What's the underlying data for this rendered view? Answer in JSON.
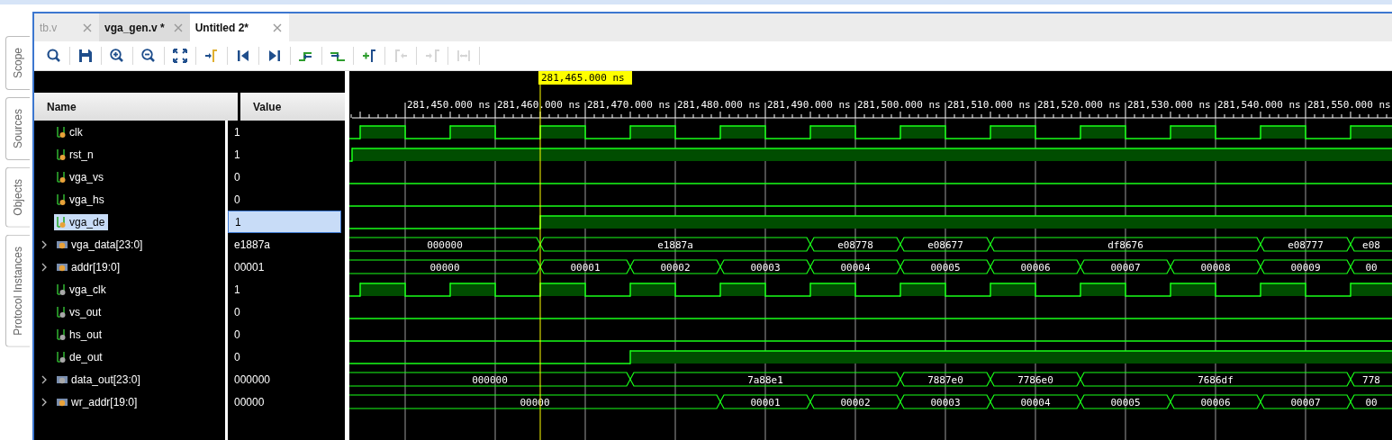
{
  "sidebar_tabs": [
    {
      "label": "Scope"
    },
    {
      "label": "Sources"
    },
    {
      "label": "Objects"
    },
    {
      "label": "Protocol Instances"
    }
  ],
  "tabs": [
    {
      "label": "tb.v",
      "selected": false,
      "dimmed": true
    },
    {
      "label": "vga_gen.v *",
      "selected": false,
      "dimmed": false
    },
    {
      "label": "Untitled 2*",
      "selected": true,
      "dimmed": false
    }
  ],
  "toolbar": [
    {
      "kind": "search",
      "disabled": false
    },
    {
      "kind": "save",
      "disabled": false
    },
    {
      "kind": "zoom-in",
      "disabled": false
    },
    {
      "kind": "zoom-out",
      "disabled": false
    },
    {
      "kind": "zoom-fit",
      "disabled": false
    },
    {
      "kind": "go-cursor",
      "disabled": false
    },
    {
      "kind": "go-start",
      "disabled": false
    },
    {
      "kind": "go-end",
      "disabled": false
    },
    {
      "kind": "prev-transition",
      "disabled": false
    },
    {
      "kind": "next-transition",
      "disabled": false
    },
    {
      "kind": "add-marker",
      "disabled": false
    },
    {
      "kind": "prev-marker",
      "disabled": true
    },
    {
      "kind": "next-marker",
      "disabled": true
    },
    {
      "kind": "swap-markers",
      "disabled": true
    }
  ],
  "columns": {
    "name": "Name",
    "value": "Value"
  },
  "waveform": {
    "cursor": "281,465.000 ns",
    "time_labels": [
      "281,450.000 ns",
      "281,460.000 ns",
      "281,470.000 ns",
      "281,480.000 ns",
      "281,490.000 ns",
      "281,500.000 ns",
      "281,510.000 ns",
      "281,520.000 ns",
      "281,530.000 ns",
      "281,540.000 ns",
      "281,550.000 ns"
    ]
  },
  "signals": [
    {
      "name": "clk",
      "value": "1",
      "kind": "bit",
      "color": "#e8a23a",
      "selected": false,
      "segments": [
        {
          "high": false
        },
        {
          "high": true
        },
        {
          "high": false
        },
        {
          "high": true
        },
        {
          "high": false
        },
        {
          "high": true
        },
        {
          "high": false
        },
        {
          "high": true
        },
        {
          "high": false
        },
        {
          "high": true
        },
        {
          "high": false
        },
        {
          "high": true
        },
        {
          "high": false
        },
        {
          "high": true
        },
        {
          "high": false
        },
        {
          "high": true
        },
        {
          "high": false
        },
        {
          "high": true
        },
        {
          "high": false
        },
        {
          "high": true
        },
        {
          "high": false
        },
        {
          "high": true
        },
        {
          "high": false
        },
        {
          "high": true
        }
      ]
    },
    {
      "name": "rst_n",
      "value": "1",
      "kind": "bit",
      "color": "#e8a23a",
      "selected": false,
      "segments": [
        {
          "high": false
        },
        {
          "high": true
        }
      ]
    },
    {
      "name": "vga_vs",
      "value": "0",
      "kind": "bit",
      "color": "#e8a23a",
      "selected": false,
      "segments": [
        {
          "high": false
        }
      ]
    },
    {
      "name": "vga_hs",
      "value": "0",
      "kind": "bit",
      "color": "#e8a23a",
      "selected": false,
      "segments": [
        {
          "high": false
        }
      ]
    },
    {
      "name": "vga_de",
      "value": "1",
      "kind": "bit",
      "color": "#e8a23a",
      "selected": true,
      "segments": [
        {
          "high": false
        },
        {
          "high": true
        }
      ]
    },
    {
      "name": "vga_data[23:0]",
      "value": "e1887a",
      "kind": "bus",
      "color": "#e8a23a",
      "selected": false,
      "expanded": false,
      "segments": [
        {
          "label": "000000"
        },
        {
          "label": "e1887a"
        },
        {
          "label": "e08778"
        },
        {
          "label": "e08677"
        },
        {
          "label": "df8676"
        },
        {
          "label": "e08777"
        },
        {
          "label": "e08"
        }
      ]
    },
    {
      "name": "addr[19:0]",
      "value": "00001",
      "kind": "bus",
      "color": "#e8a23a",
      "selected": false,
      "expanded": false,
      "segments": [
        {
          "label": "00000"
        },
        {
          "label": "00001"
        },
        {
          "label": "00002"
        },
        {
          "label": "00003"
        },
        {
          "label": "00004"
        },
        {
          "label": "00005"
        },
        {
          "label": "00006"
        },
        {
          "label": "00007"
        },
        {
          "label": "00008"
        },
        {
          "label": "00009"
        },
        {
          "label": "00"
        }
      ]
    },
    {
      "name": "vga_clk",
      "value": "1",
      "kind": "bit",
      "color": "#a8a8a8",
      "selected": false,
      "segments": [
        {
          "high": false
        },
        {
          "high": true
        },
        {
          "high": false
        },
        {
          "high": true
        },
        {
          "high": false
        },
        {
          "high": true
        },
        {
          "high": false
        },
        {
          "high": true
        },
        {
          "high": false
        },
        {
          "high": true
        },
        {
          "high": false
        },
        {
          "high": true
        },
        {
          "high": false
        },
        {
          "high": true
        },
        {
          "high": false
        },
        {
          "high": true
        },
        {
          "high": false
        },
        {
          "high": true
        },
        {
          "high": false
        },
        {
          "high": true
        },
        {
          "high": false
        },
        {
          "high": true
        },
        {
          "high": false
        },
        {
          "high": true
        }
      ]
    },
    {
      "name": "vs_out",
      "value": "0",
      "kind": "bit",
      "color": "#a8a8a8",
      "selected": false,
      "segments": [
        {
          "high": false
        }
      ]
    },
    {
      "name": "hs_out",
      "value": "0",
      "kind": "bit",
      "color": "#a8a8a8",
      "selected": false,
      "segments": [
        {
          "high": false
        }
      ]
    },
    {
      "name": "de_out",
      "value": "0",
      "kind": "bit",
      "color": "#a8a8a8",
      "selected": false,
      "segments": [
        {
          "high": false
        },
        {
          "high": true
        }
      ]
    },
    {
      "name": "data_out[23:0]",
      "value": "000000",
      "kind": "bus",
      "color": "#a8a8a8",
      "selected": false,
      "expanded": false,
      "segments": [
        {
          "label": "000000"
        },
        {
          "label": "7a88e1"
        },
        {
          "label": "7887e0"
        },
        {
          "label": "7786e0"
        },
        {
          "label": "7686df"
        },
        {
          "label": "778"
        }
      ]
    },
    {
      "name": "wr_addr[19:0]",
      "value": "00000",
      "kind": "bus",
      "color": "#e8a23a",
      "selected": false,
      "expanded": false,
      "segments": [
        {
          "label": "00000"
        },
        {
          "label": "00001"
        },
        {
          "label": "00002"
        },
        {
          "label": "00003"
        },
        {
          "label": "00004"
        },
        {
          "label": "00005"
        },
        {
          "label": "00006"
        },
        {
          "label": "00007"
        },
        {
          "label": "00"
        }
      ]
    }
  ]
}
